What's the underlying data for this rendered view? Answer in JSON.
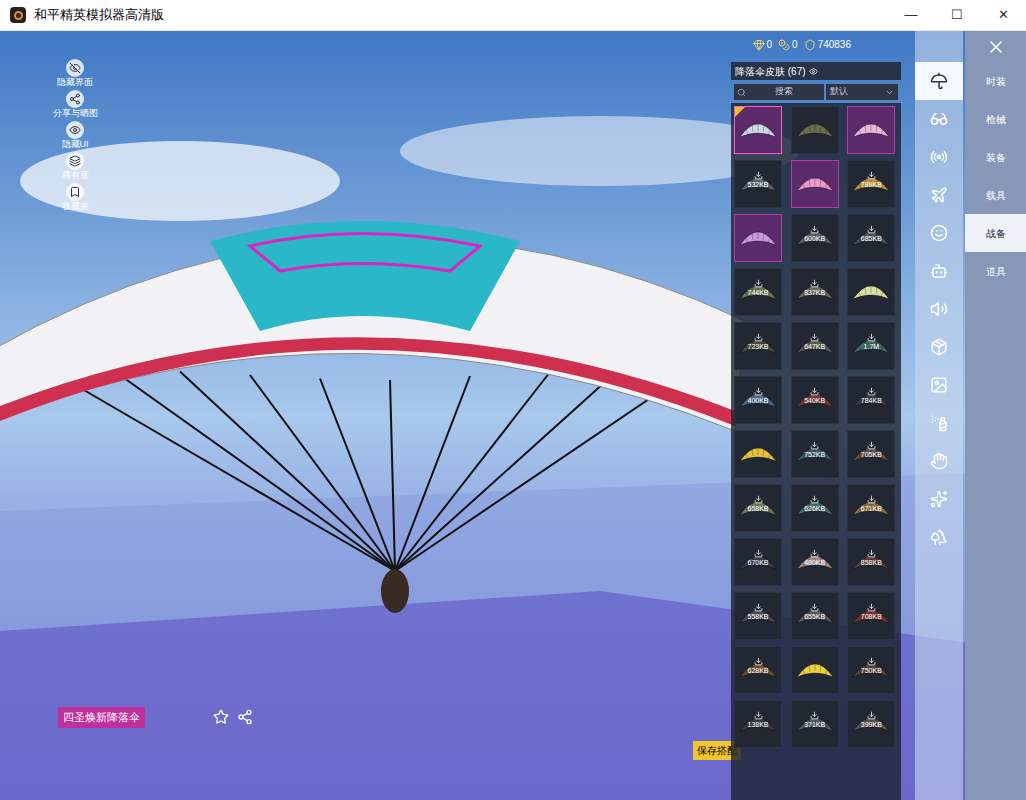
{
  "window": {
    "title": "和平精英模拟器高清版",
    "controls": [
      "—",
      "☐",
      "✕"
    ]
  },
  "currency": [
    {
      "value": "0"
    },
    {
      "value": "0"
    },
    {
      "value": "740836"
    }
  ],
  "left_tools": [
    {
      "label": "隐藏界面"
    },
    {
      "label": "分享与晒图"
    },
    {
      "label": "隐藏UI"
    },
    {
      "label": "稀有度"
    },
    {
      "label": "收藏夹"
    }
  ],
  "panel": {
    "title": "降落伞皮肤 (67)",
    "search": {
      "placeholder": "搜索"
    },
    "sort": {
      "value": "默认"
    },
    "items": [
      {
        "size": "",
        "color": "#cfd8e8",
        "highlight": true,
        "selected": true,
        "new": true
      },
      {
        "size": "",
        "color": "#6b6b4a",
        "highlight": false,
        "selected": false,
        "new": false
      },
      {
        "size": "",
        "color": "#e8b8d8",
        "highlight": true,
        "selected": false,
        "new": false
      },
      {
        "size": "532KB",
        "color": "#5a6470",
        "highlight": false,
        "selected": false,
        "new": false
      },
      {
        "size": "",
        "color": "#e89ac8",
        "highlight": true,
        "selected": false,
        "new": false
      },
      {
        "size": "789KB",
        "color": "#b89040",
        "highlight": false,
        "selected": false,
        "new": false
      },
      {
        "size": "",
        "color": "#c89ad8",
        "highlight": true,
        "selected": false,
        "new": false
      },
      {
        "size": "600KB",
        "color": "#5a5f66",
        "highlight": false,
        "selected": false,
        "new": false
      },
      {
        "size": "685KB",
        "color": "#4a4f58",
        "highlight": false,
        "selected": false,
        "new": false
      },
      {
        "size": "744KB",
        "color": "#6a7a50",
        "highlight": false,
        "selected": false,
        "new": false
      },
      {
        "size": "837KB",
        "color": "#6a6a5a",
        "highlight": false,
        "selected": false,
        "new": false
      },
      {
        "size": "",
        "color": "#d8e0a0",
        "highlight": false,
        "selected": false,
        "new": false
      },
      {
        "size": "723KB",
        "color": "#4a4a40",
        "highlight": false,
        "selected": false,
        "new": false
      },
      {
        "size": "647KB",
        "color": "#5a5a5a",
        "highlight": false,
        "selected": false,
        "new": false
      },
      {
        "size": "1.7M",
        "color": "#3f6a60",
        "highlight": false,
        "selected": false,
        "new": false
      },
      {
        "size": "400KB",
        "color": "#4a6a88",
        "highlight": false,
        "selected": false,
        "new": false
      },
      {
        "size": "540KB",
        "color": "#7a3a3a",
        "highlight": false,
        "selected": false,
        "new": false
      },
      {
        "size": "784KB",
        "color": "#3a3a48",
        "highlight": false,
        "selected": false,
        "new": false
      },
      {
        "size": "",
        "color": "#e8c040",
        "highlight": false,
        "selected": false,
        "new": false
      },
      {
        "size": "752KB",
        "color": "#3a5a6a",
        "highlight": false,
        "selected": false,
        "new": false
      },
      {
        "size": "705KB",
        "color": "#5a5048",
        "highlight": false,
        "selected": false,
        "new": false
      },
      {
        "size": "658KB",
        "color": "#707860",
        "highlight": false,
        "selected": false,
        "new": false
      },
      {
        "size": "626KB",
        "color": "#4a6a70",
        "highlight": false,
        "selected": false,
        "new": false
      },
      {
        "size": "671KB",
        "color": "#8a7040",
        "highlight": false,
        "selected": false,
        "new": false
      },
      {
        "size": "670KB",
        "color": "#3a4048",
        "highlight": false,
        "selected": false,
        "new": false
      },
      {
        "size": "480KB",
        "color": "#a08a88",
        "highlight": false,
        "selected": false,
        "new": false
      },
      {
        "size": "858KB",
        "color": "#5a3a3a",
        "highlight": false,
        "selected": false,
        "new": false
      },
      {
        "size": "558KB",
        "color": "#4a4a50",
        "highlight": false,
        "selected": false,
        "new": false
      },
      {
        "size": "655KB",
        "color": "#5a5a5a",
        "highlight": false,
        "selected": false,
        "new": false
      },
      {
        "size": "708KB",
        "color": "#7a3030",
        "highlight": false,
        "selected": false,
        "new": false
      },
      {
        "size": "628KB",
        "color": "#6a5030",
        "highlight": false,
        "selected": false,
        "new": false
      },
      {
        "size": "",
        "color": "#e8d040",
        "highlight": false,
        "selected": false,
        "new": false
      },
      {
        "size": "750KB",
        "color": "#5a4038",
        "highlight": false,
        "selected": false,
        "new": false
      },
      {
        "size": "138KB",
        "color": "#3a3a40",
        "highlight": false,
        "selected": false,
        "new": false
      },
      {
        "size": "371KB",
        "color": "#505860",
        "highlight": false,
        "selected": false,
        "new": false
      },
      {
        "size": "399KB",
        "color": "#5a5050",
        "highlight": false,
        "selected": false,
        "new": false
      }
    ]
  },
  "icon_tabs": [
    {
      "selected": true
    },
    {
      "selected": false
    },
    {
      "selected": false
    },
    {
      "selected": false
    },
    {
      "selected": false
    },
    {
      "selected": false
    },
    {
      "selected": false
    },
    {
      "selected": false
    },
    {
      "selected": false
    },
    {
      "selected": false
    },
    {
      "selected": false
    },
    {
      "selected": false
    },
    {
      "selected": false
    }
  ],
  "categories": [
    {
      "label": "时装",
      "selected": false
    },
    {
      "label": "枪械",
      "selected": false
    },
    {
      "label": "装备",
      "selected": false
    },
    {
      "label": "载具",
      "selected": false
    },
    {
      "label": "战备",
      "selected": true
    },
    {
      "label": "道具",
      "selected": false
    }
  ],
  "current_item": {
    "name": "四圣焕新降落伞"
  },
  "save_button": {
    "label": "保存搭配"
  }
}
